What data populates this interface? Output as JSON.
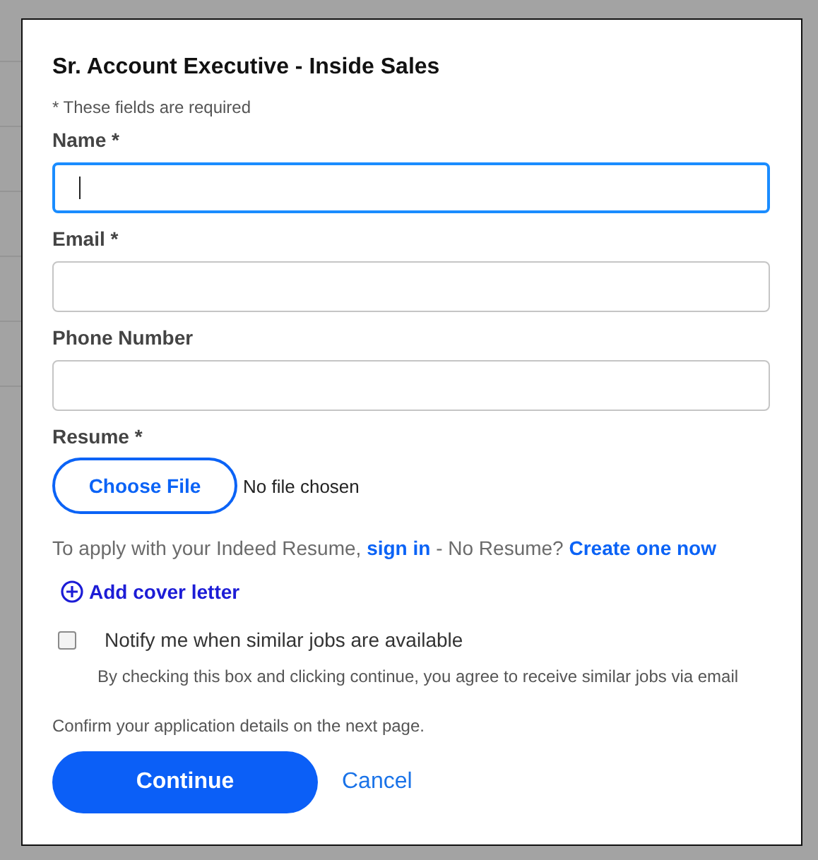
{
  "dialog": {
    "title": "Sr. Account Executive - Inside Sales",
    "required_note": "* These fields are required",
    "fields": [
      {
        "label": "Name *",
        "focused": true
      },
      {
        "label": "Email *",
        "focused": false
      },
      {
        "label": "Phone Number",
        "focused": false
      }
    ],
    "resume": {
      "label": "Resume *",
      "button": "Choose File",
      "status": "No file chosen"
    },
    "indeed_line": {
      "before": "To apply with your Indeed Resume,",
      "sign_in": "sign in",
      "middle": "- No Resume?",
      "create": "Create one now"
    },
    "cover_letter": "Add cover letter",
    "notify": {
      "label": "Notify me when similar jobs are available",
      "checked": false,
      "note": "By checking this box and clicking continue, you agree to receive similar jobs via email"
    },
    "confirm_note": "Confirm your application details on the next page.",
    "continue_button": "Continue",
    "cancel_link": "Cancel"
  }
}
